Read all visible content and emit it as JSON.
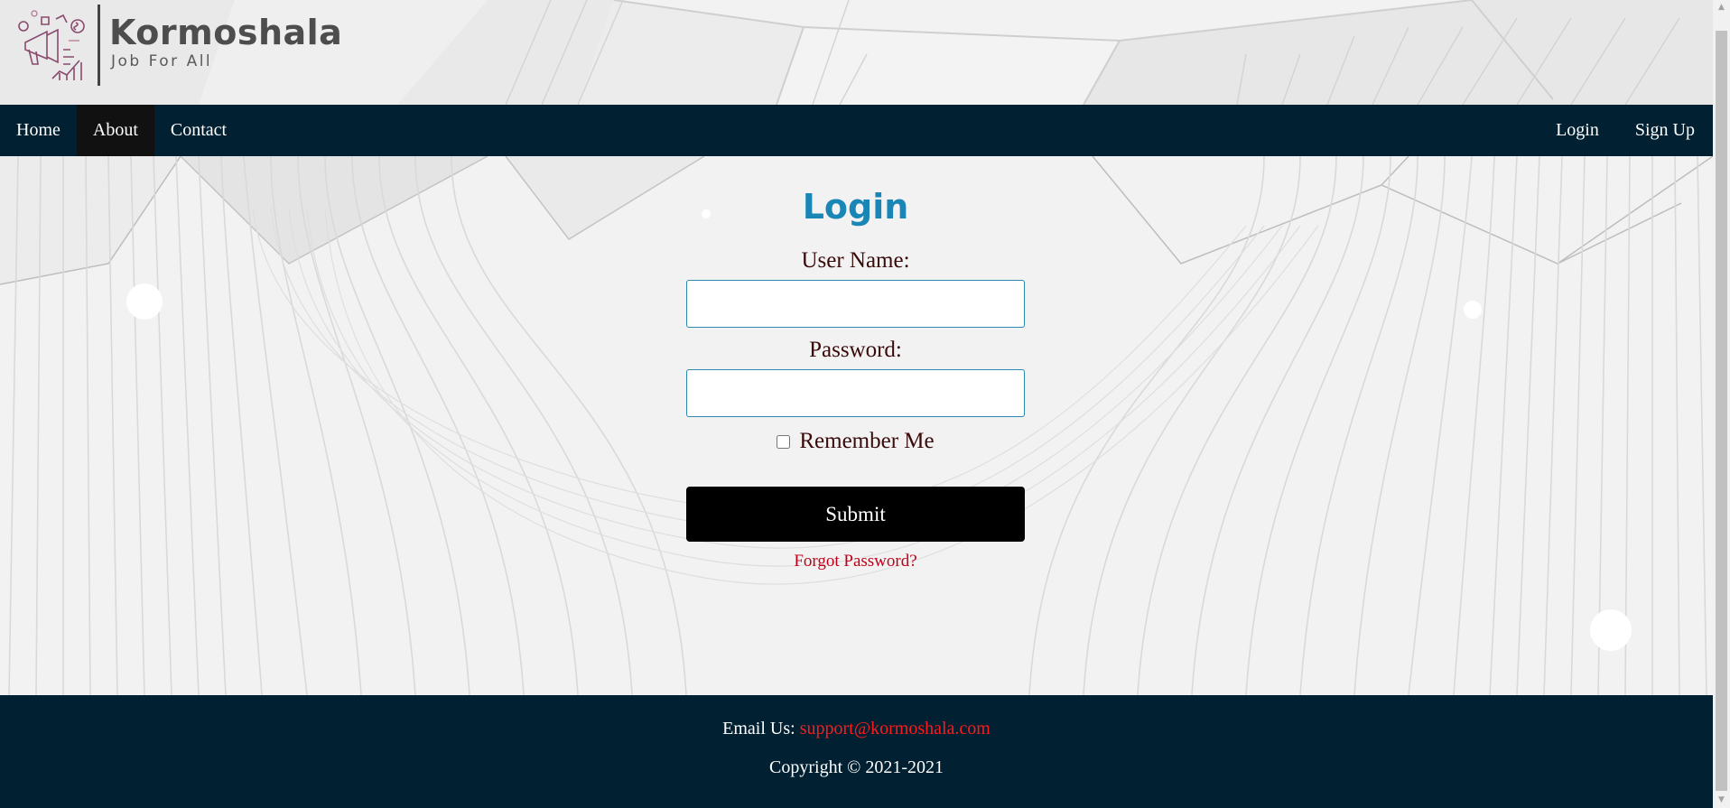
{
  "brand": {
    "name": "Kormoshala",
    "tagline": "Job For All"
  },
  "nav": {
    "left": [
      {
        "label": "Home",
        "active": false
      },
      {
        "label": "About",
        "active": true
      },
      {
        "label": "Contact",
        "active": false
      }
    ],
    "right": [
      {
        "label": "Login"
      },
      {
        "label": "Sign Up"
      }
    ]
  },
  "login_form": {
    "title": "Login",
    "username_label": "User Name:",
    "username_value": "",
    "password_label": "Password:",
    "password_value": "",
    "remember_label": "Remember Me",
    "remember_checked": false,
    "submit_label": "Submit",
    "forgot_label": "Forgot Password?"
  },
  "footer": {
    "email_prefix": "Email Us:",
    "email": "support@kormoshala.com",
    "copyright": "Copyright © 2021-2021"
  },
  "colors": {
    "nav_bg": "#012133",
    "active_nav_bg": "#111111",
    "title": "#1a86b5",
    "link_red": "#c0001a",
    "footer_link": "#ff1a1a",
    "submit_bg": "#000000"
  }
}
